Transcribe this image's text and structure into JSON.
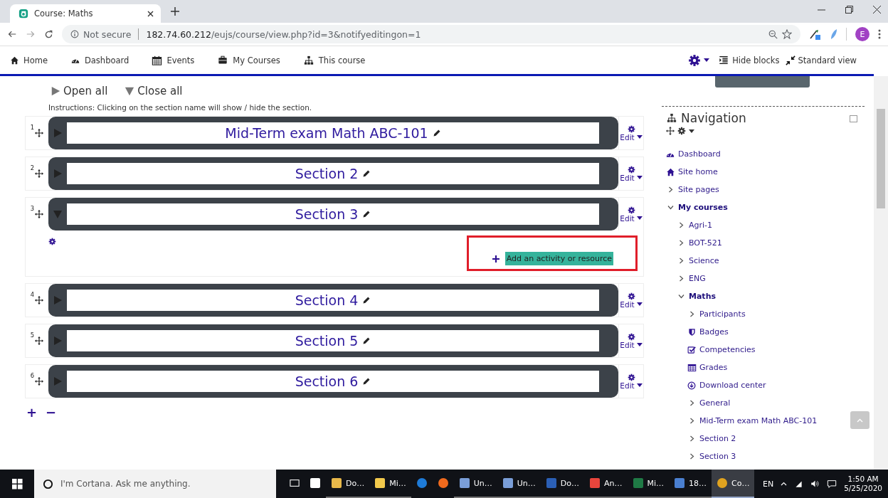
{
  "browser": {
    "tab_title": "Course: Maths",
    "security": "Not secure",
    "host": "182.74.60.212",
    "path": "/eujs/course/view.php?id=3&notifyeditingon=1",
    "profile": "E"
  },
  "navbar": {
    "items": [
      {
        "label": "Home",
        "kind": "home"
      },
      {
        "label": "Dashboard",
        "kind": "dashboard"
      },
      {
        "label": "Events",
        "kind": "calendar"
      },
      {
        "label": "My Courses",
        "kind": "briefcase"
      },
      {
        "label": "This course",
        "kind": "sitemap"
      }
    ],
    "actions": [
      {
        "label": "Hide blocks",
        "kind": "hide"
      },
      {
        "label": "Standard view",
        "kind": "compress"
      }
    ]
  },
  "toggles": [
    {
      "label": "Open all",
      "kind": "open"
    },
    {
      "label": "Close all",
      "kind": "close"
    }
  ],
  "instructions": "Instructions: Clicking on the section name will show / hide the section.",
  "sections": [
    {
      "number": "1",
      "title": "Mid-Term exam Math ABC-101",
      "expanded": false,
      "edit": "Edit"
    },
    {
      "number": "2",
      "title": "Section 2",
      "expanded": false,
      "edit": "Edit"
    },
    {
      "number": "3",
      "title": "Section 3",
      "expanded": true,
      "edit": "Edit",
      "add_activity": "Add an activity or resource"
    },
    {
      "number": "4",
      "title": "Section 4",
      "expanded": false,
      "edit": "Edit"
    },
    {
      "number": "5",
      "title": "Section 5",
      "expanded": false,
      "edit": "Edit"
    },
    {
      "number": "6",
      "title": "Section 6",
      "expanded": false,
      "edit": "Edit"
    }
  ],
  "section_controls": [
    "+",
    "−"
  ],
  "navigation": {
    "title": "Navigation",
    "items": [
      {
        "label": "Dashboard",
        "kind": "dashboard"
      },
      {
        "label": "Site home",
        "kind": "home"
      },
      {
        "label": "Site pages",
        "kind": "node",
        "expanded": false
      },
      {
        "label": "My courses",
        "kind": "node",
        "expanded": true,
        "children": [
          {
            "label": "Agri-1",
            "kind": "node",
            "expanded": false
          },
          {
            "label": "BOT-521",
            "kind": "node",
            "expanded": false
          },
          {
            "label": "Science",
            "kind": "node",
            "expanded": false
          },
          {
            "label": "ENG",
            "kind": "node",
            "expanded": false
          },
          {
            "label": "Maths",
            "kind": "node",
            "expanded": true,
            "children": [
              {
                "label": "Participants",
                "kind": "node",
                "expanded": false
              },
              {
                "label": "Badges",
                "kind": "badge"
              },
              {
                "label": "Competencies",
                "kind": "check"
              },
              {
                "label": "Grades",
                "kind": "table"
              },
              {
                "label": "Download center",
                "kind": "download"
              },
              {
                "label": "General",
                "kind": "node",
                "expanded": false
              },
              {
                "label": "Mid-Term exam Math ABC-101",
                "kind": "node",
                "expanded": false
              },
              {
                "label": "Section 2",
                "kind": "node",
                "expanded": false
              },
              {
                "label": "Section 3",
                "kind": "node",
                "expanded": false
              }
            ]
          }
        ]
      }
    ]
  },
  "taskbar": {
    "search_placeholder": "I'm Cortana. Ask me anything.",
    "apps": [
      {
        "kind": "taskview",
        "selected": false
      },
      {
        "kind": "store",
        "selected": false
      },
      {
        "label": "Do…",
        "kind": "folderdoc",
        "selected": false
      },
      {
        "label": "Mi…",
        "kind": "folder",
        "selected": false
      },
      {
        "kind": "edge",
        "selected": false
      },
      {
        "kind": "firefox",
        "selected": false
      },
      {
        "label": "Un…",
        "kind": "paint",
        "selected": false
      },
      {
        "label": "Un…",
        "kind": "paint",
        "selected": false
      },
      {
        "label": "Do…",
        "kind": "word",
        "selected": false
      },
      {
        "label": "An…",
        "kind": "anydesk",
        "selected": false
      },
      {
        "label": "Mi…",
        "kind": "excel",
        "selected": false
      },
      {
        "label": "18…",
        "kind": "network",
        "selected": false
      },
      {
        "label": "Co…",
        "kind": "chrome",
        "selected": true
      }
    ],
    "language": "EN",
    "time": "1:50 AM",
    "date": "5/25/2020"
  }
}
